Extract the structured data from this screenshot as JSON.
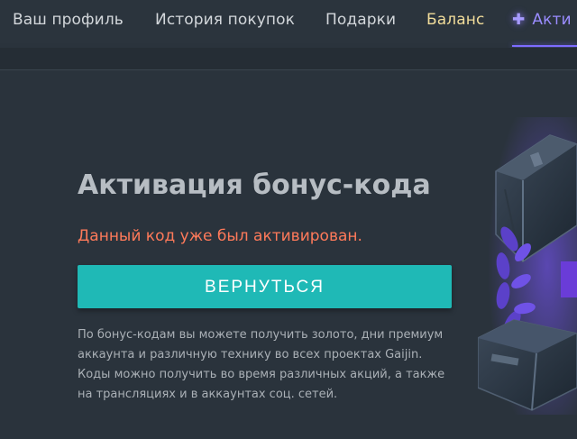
{
  "nav": {
    "items": [
      {
        "label": "Ваш профиль"
      },
      {
        "label": "История покупок"
      },
      {
        "label": "Подарки"
      },
      {
        "label": "Баланс"
      },
      {
        "label": "Акти"
      }
    ],
    "active_icon": "plus-icon"
  },
  "main": {
    "title": "Активация бонус-кода",
    "error": "Данный код уже был активирован.",
    "back_button_label": "ВЕРНУТЬСЯ",
    "info_lines": [
      "По бонус-кодам вы можете получить золото, дни премиум",
      "аккаунта и различную технику во всех проектах Gaijin.",
      "Коды можно получить во время различных акций, а также",
      "на трансляциях и в аккаунтах соц. сетей."
    ]
  },
  "colors": {
    "background": "#2a333c",
    "accent_teal": "#1fb9b6",
    "error": "#ff7a5a",
    "balance": "#f1dc9a",
    "active_tab": "#9a8cff"
  }
}
